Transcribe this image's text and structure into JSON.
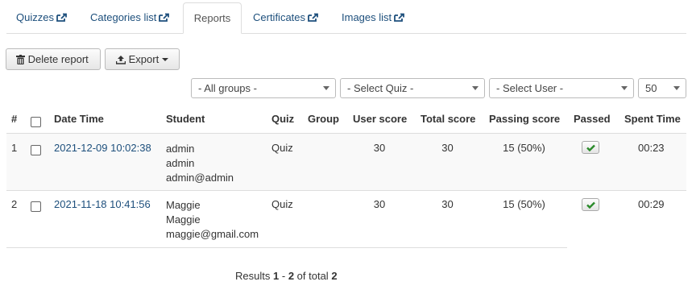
{
  "tabs": [
    {
      "label": "Quizzes",
      "icon": "external-link-icon",
      "active": false
    },
    {
      "label": "Categories list",
      "icon": "external-link-icon",
      "active": false
    },
    {
      "label": "Reports",
      "icon": "",
      "active": true
    },
    {
      "label": "Certificates",
      "icon": "external-link-icon",
      "active": false
    },
    {
      "label": "Images list",
      "icon": "external-link-icon",
      "active": false
    }
  ],
  "toolbar": {
    "delete_label": "Delete report",
    "export_label": "Export"
  },
  "filters": {
    "groups": "- All groups -",
    "quiz": "- Select Quiz -",
    "user": "- Select User -",
    "limit": "50"
  },
  "table": {
    "headers": [
      "#",
      "Date Time",
      "Student",
      "Quiz",
      "Group",
      "User score",
      "Total score",
      "Passing score",
      "Passed",
      "Spent Time"
    ],
    "rows": [
      {
        "num": "1",
        "datetime": "2021-12-09 10:02:38",
        "student_name": "admin",
        "student_username": "admin",
        "student_email": "admin@admin",
        "quiz": "Quiz",
        "group": "",
        "user_score": "30",
        "total_score": "30",
        "passing_score": "15 (50%)",
        "passed": true,
        "spent_time": "00:23"
      },
      {
        "num": "2",
        "datetime": "2021-11-18 10:41:56",
        "student_name": "Maggie",
        "student_username": "Maggie",
        "student_email": "maggie@gmail.com",
        "quiz": "Quiz",
        "group": "",
        "user_score": "30",
        "total_score": "30",
        "passing_score": "15 (50%)",
        "passed": true,
        "spent_time": "00:29"
      }
    ]
  },
  "pagination": {
    "prefix": "Results",
    "from": "1",
    "dash": "-",
    "to": "2",
    "of_total": "of total",
    "total": "2"
  },
  "colors": {
    "link": "#1d4f7c",
    "check": "#2a8a2a"
  }
}
